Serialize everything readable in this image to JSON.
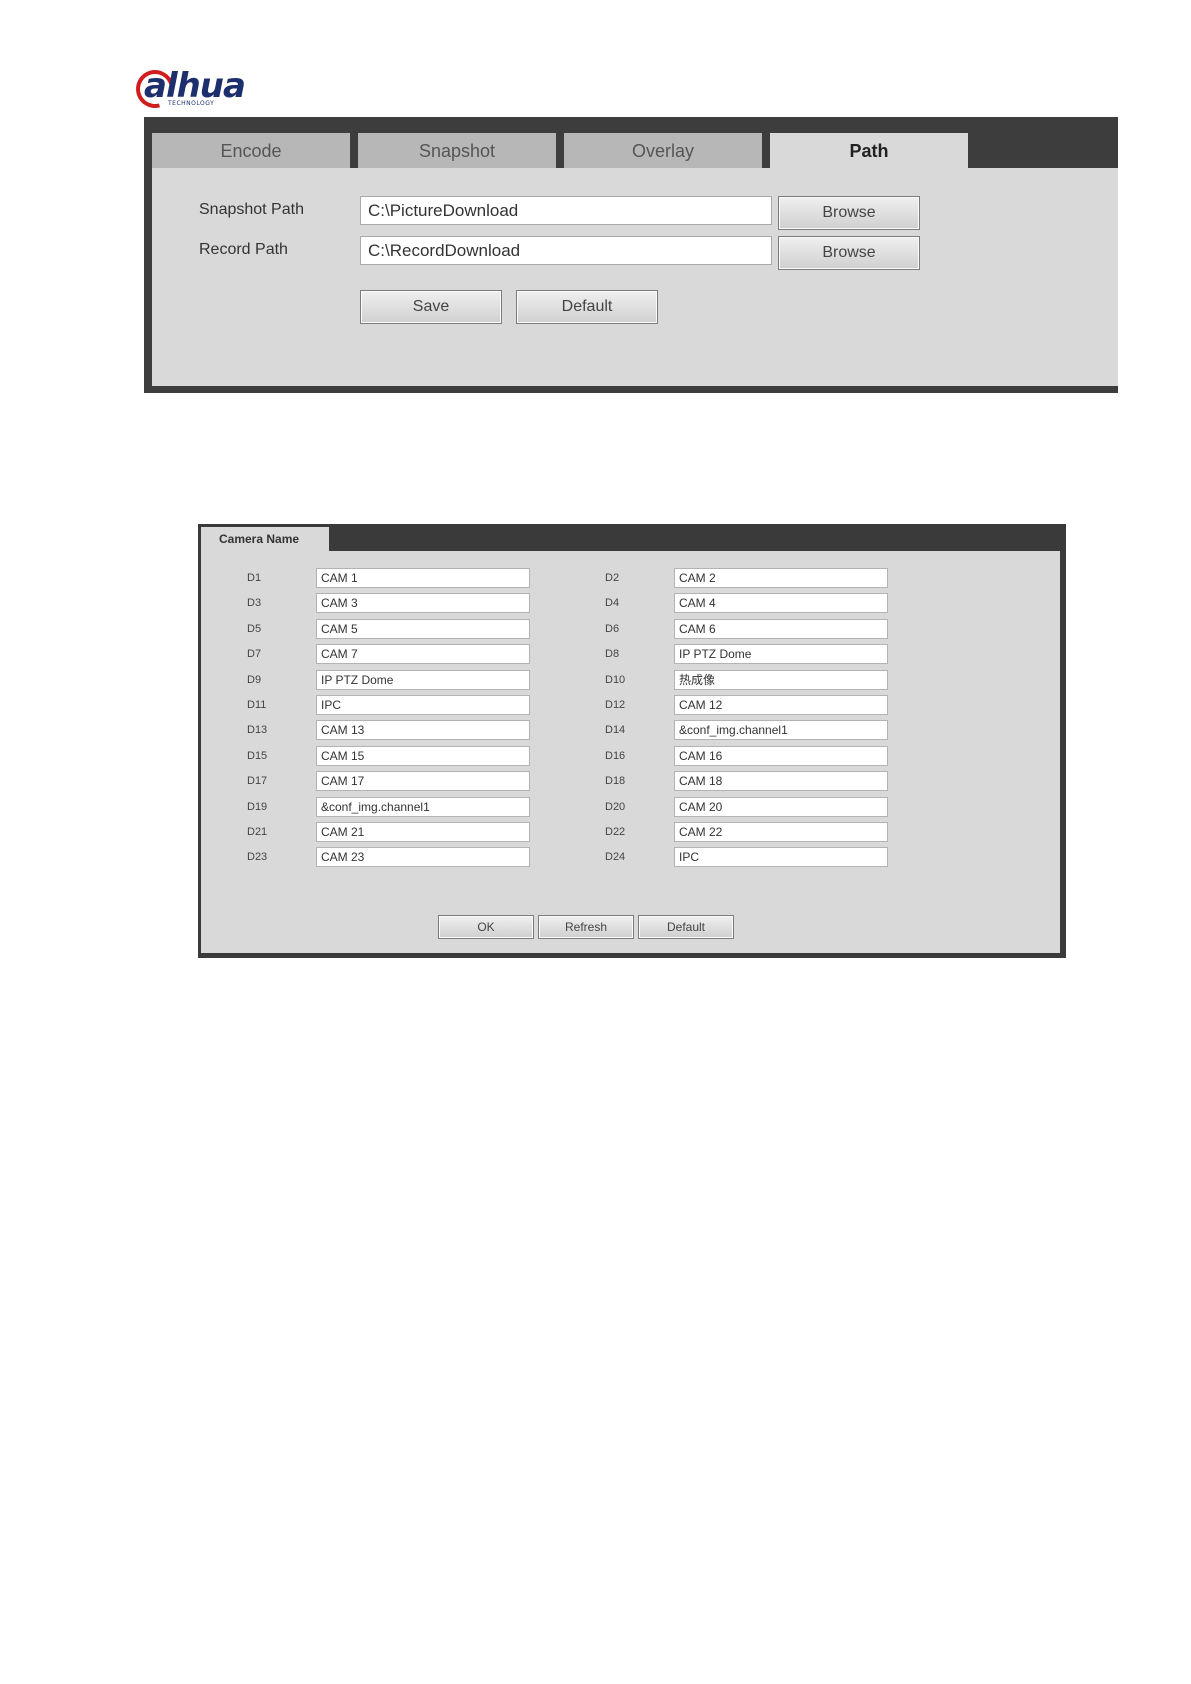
{
  "logo": {
    "word": "alhua",
    "tagline": "TECHNOLOGY"
  },
  "path_panel": {
    "tabs": [
      "Encode",
      "Snapshot",
      "Overlay",
      "Path"
    ],
    "active_tab": "Path",
    "snapshot_path_label": "Snapshot Path",
    "snapshot_path_value": "C:\\PictureDownload",
    "record_path_label": "Record Path",
    "record_path_value": "C:\\RecordDownload",
    "browse_label": "Browse",
    "save_label": "Save",
    "default_label": "Default"
  },
  "camera_panel": {
    "tab_label": "Camera Name",
    "rows": [
      {
        "left_label": "D1",
        "left_value": "CAM 1",
        "right_label": "D2",
        "right_value": "CAM 2"
      },
      {
        "left_label": "D3",
        "left_value": "CAM 3",
        "right_label": "D4",
        "right_value": "CAM 4"
      },
      {
        "left_label": "D5",
        "left_value": "CAM 5",
        "right_label": "D6",
        "right_value": "CAM 6"
      },
      {
        "left_label": "D7",
        "left_value": "CAM 7",
        "right_label": "D8",
        "right_value": "IP PTZ Dome"
      },
      {
        "left_label": "D9",
        "left_value": "IP PTZ Dome",
        "right_label": "D10",
        "right_value": "热成像"
      },
      {
        "left_label": "D11",
        "left_value": "IPC",
        "right_label": "D12",
        "right_value": "CAM 12"
      },
      {
        "left_label": "D13",
        "left_value": "CAM 13",
        "right_label": "D14",
        "right_value": "&conf_img.channel1"
      },
      {
        "left_label": "D15",
        "left_value": "CAM 15",
        "right_label": "D16",
        "right_value": "CAM 16"
      },
      {
        "left_label": "D17",
        "left_value": "CAM 17",
        "right_label": "D18",
        "right_value": "CAM 18"
      },
      {
        "left_label": "D19",
        "left_value": "&conf_img.channel1",
        "right_label": "D20",
        "right_value": "CAM 20"
      },
      {
        "left_label": "D21",
        "left_value": "CAM 21",
        "right_label": "D22",
        "right_value": "CAM 22"
      },
      {
        "left_label": "D23",
        "left_value": "CAM 23",
        "right_label": "D24",
        "right_value": "IPC"
      }
    ],
    "ok_label": "OK",
    "refresh_label": "Refresh",
    "default_label": "Default"
  }
}
